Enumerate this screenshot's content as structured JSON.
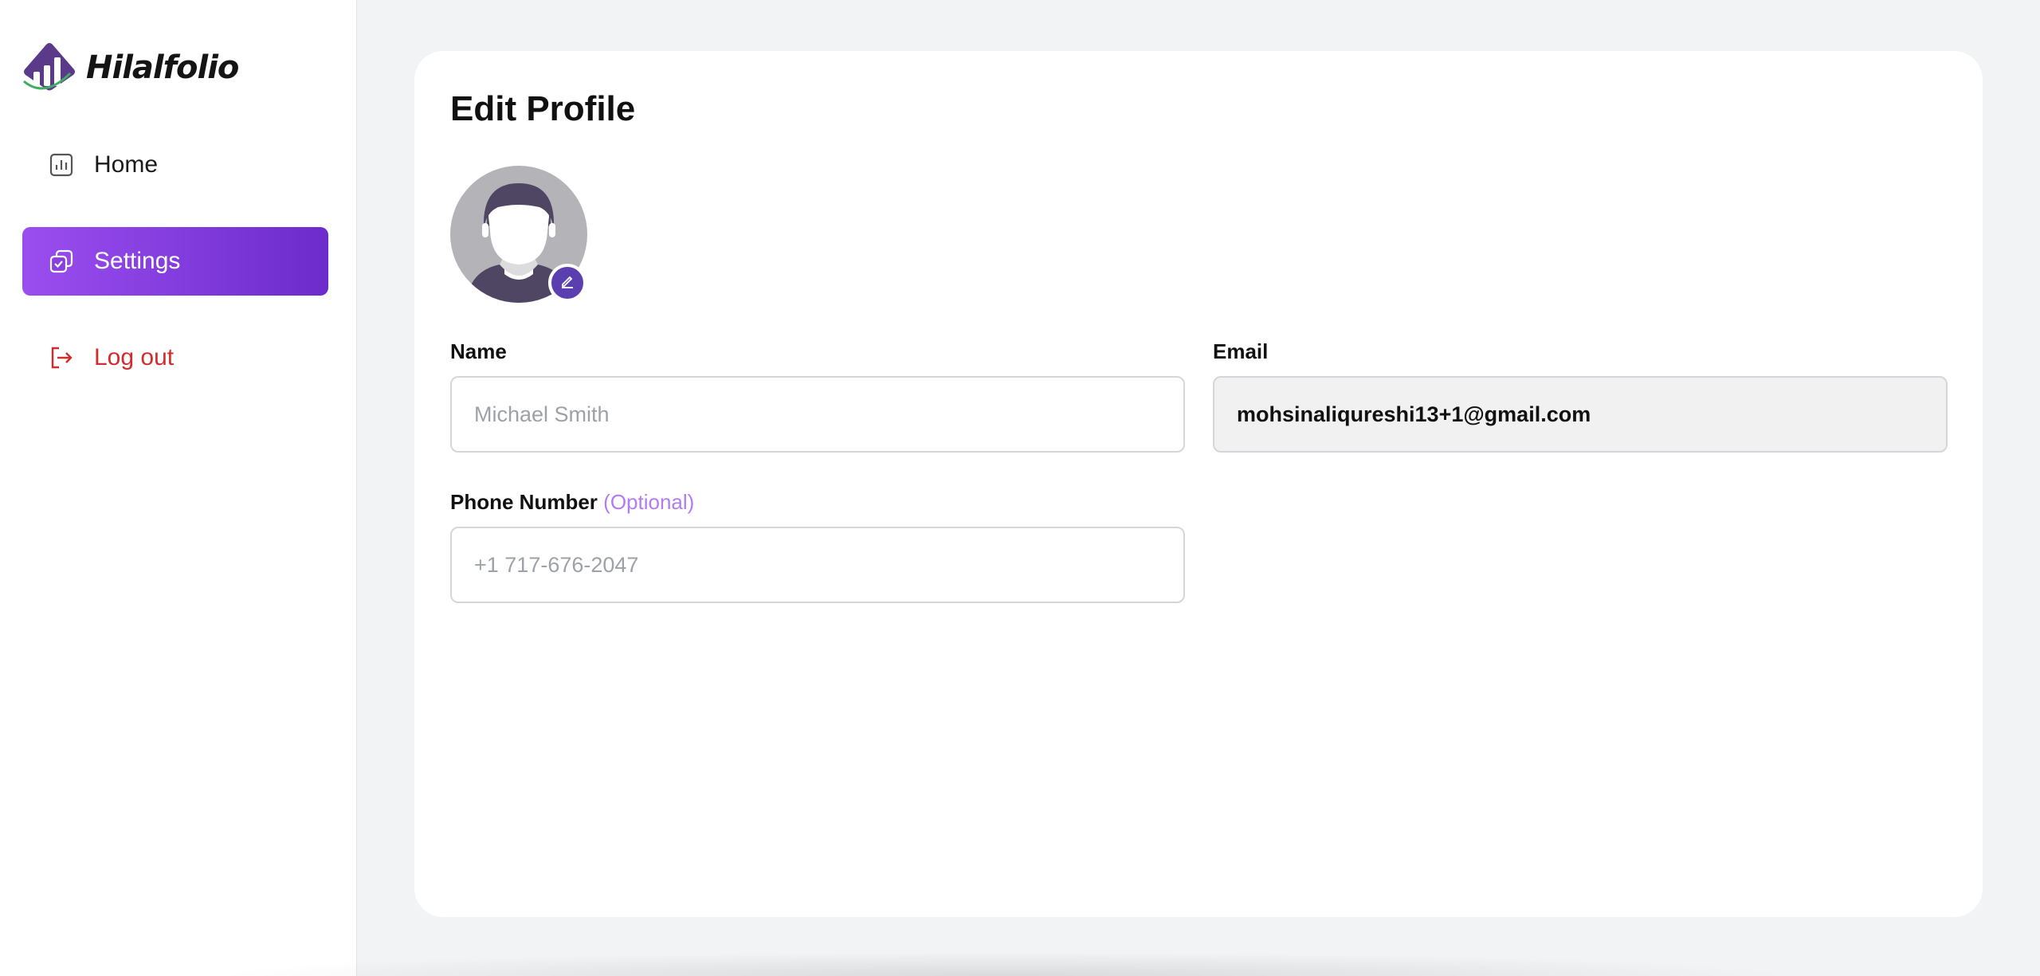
{
  "app": {
    "name": "Hilalfolio"
  },
  "sidebar": {
    "items": [
      {
        "label": "Home",
        "icon": "chart-box-icon"
      },
      {
        "label": "Settings",
        "icon": "settings-check-icon",
        "active": true
      },
      {
        "label": "Log out",
        "icon": "logout-icon"
      }
    ]
  },
  "main": {
    "title": "Edit Profile",
    "avatar": {
      "icon": "default-avatar",
      "edit_icon": "pencil-icon"
    },
    "form": {
      "name": {
        "label": "Name",
        "placeholder": "Michael Smith",
        "value": ""
      },
      "email": {
        "label": "Email",
        "value": "mohsinaliqureshi13+1@gmail.com"
      },
      "phone": {
        "label": "Phone Number",
        "optional": "(Optional)",
        "placeholder": "+1 717-676-2047",
        "value": ""
      }
    }
  },
  "colors": {
    "accent_start": "#9b4ef0",
    "accent_end": "#6c2bcb",
    "logout": "#d42a2a",
    "optional": "#b27cf0"
  }
}
